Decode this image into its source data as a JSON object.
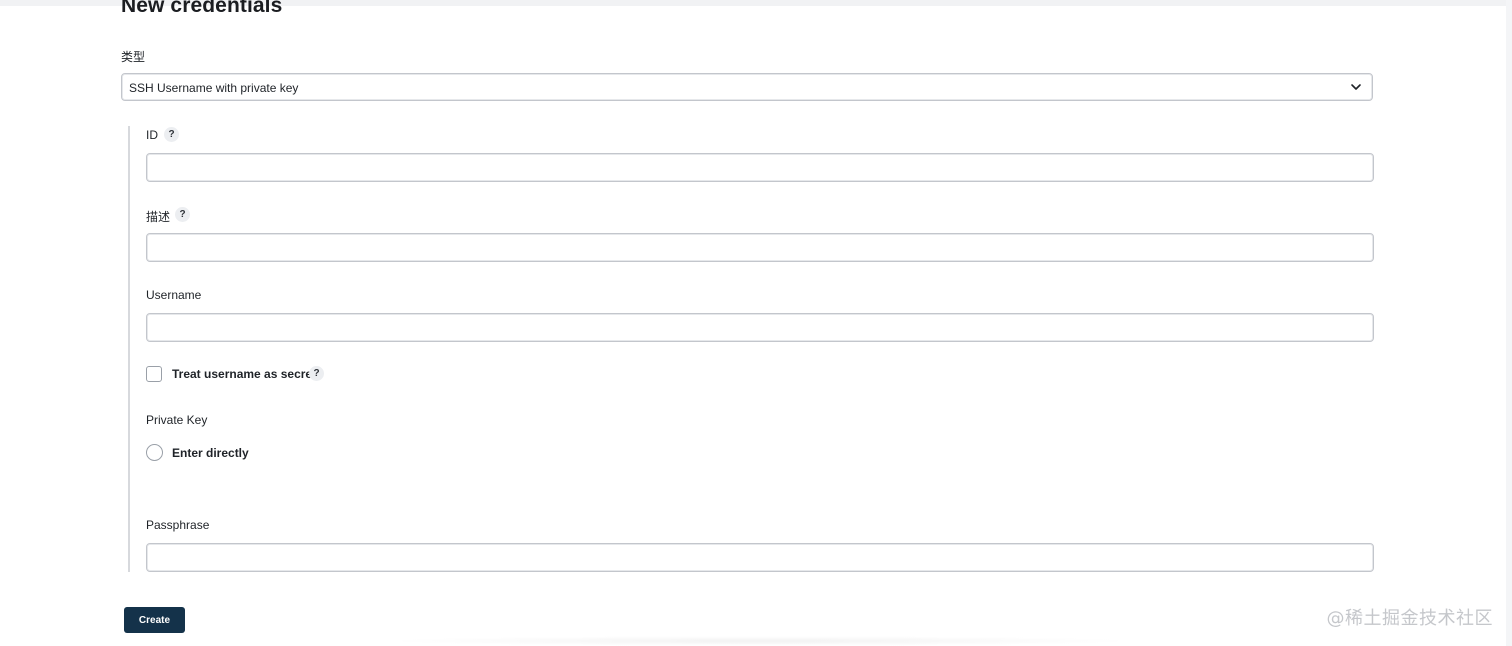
{
  "page": {
    "title": "New credentials"
  },
  "type_field": {
    "label": "类型",
    "selected_value": "SSH Username with private key"
  },
  "fields": {
    "id": {
      "label": "ID",
      "help": "?",
      "value": ""
    },
    "description": {
      "label": "描述",
      "help": "?",
      "value": ""
    },
    "username": {
      "label": "Username",
      "value": ""
    },
    "treat_username_secret": {
      "label": "Treat username as secret",
      "help": "?",
      "checked": false
    },
    "private_key": {
      "label": "Private Key",
      "option_label": "Enter directly",
      "selected": false
    },
    "passphrase": {
      "label": "Passphrase",
      "value": ""
    }
  },
  "actions": {
    "create_label": "Create"
  },
  "watermark": "@稀土掘金技术社区",
  "colors": {
    "primary_button": "#14324a",
    "border": "#c3c6cc",
    "section_line": "#d7d9dd"
  }
}
